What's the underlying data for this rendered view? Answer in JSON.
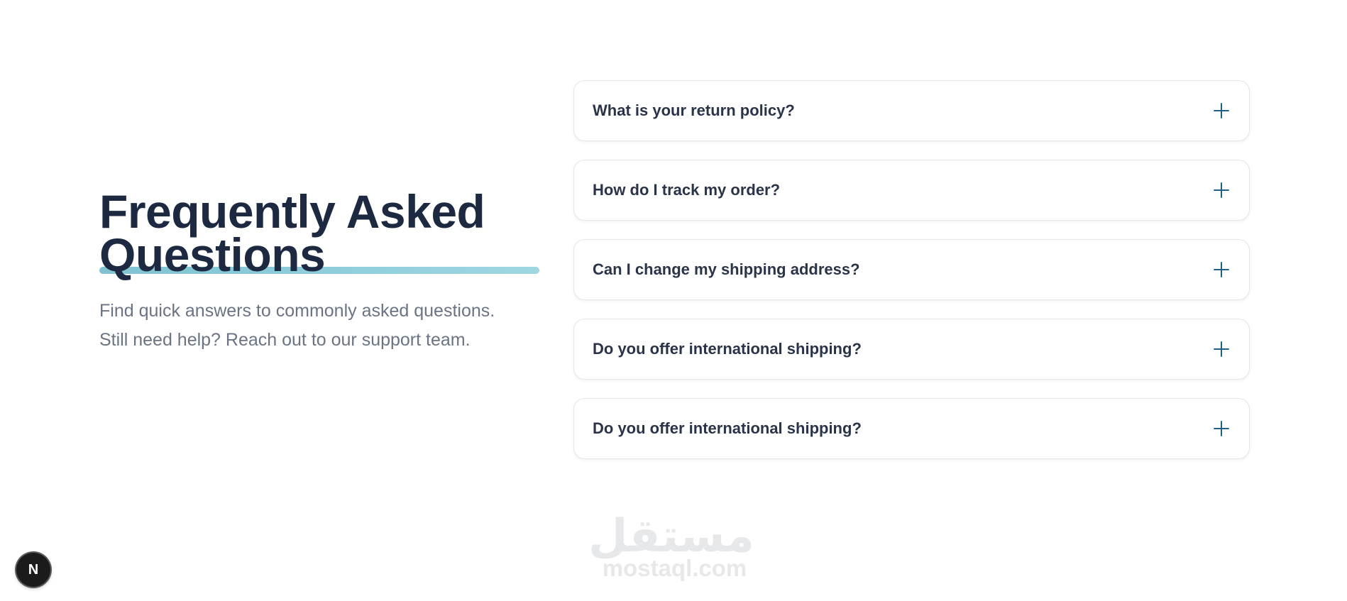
{
  "hero": {
    "title_line1": "Frequently Asked",
    "title_line2": "Questions",
    "description_line1": "Find quick answers to commonly asked questions.",
    "description_line2": "Still need help? Reach out to our support team.",
    "accent_color": "#9fd6e2",
    "title_color": "#1c2940"
  },
  "faq": {
    "expand_icon": "plus-icon",
    "icon_color": "#1f5f86",
    "items": [
      {
        "question": "What is your return policy?"
      },
      {
        "question": "How do I track my order?"
      },
      {
        "question": "Can I change my shipping address?"
      },
      {
        "question": "Do you offer international shipping?"
      },
      {
        "question": "Do you offer international shipping?"
      }
    ]
  },
  "watermark": {
    "arabic": "مستقل",
    "latin": "mostaql.com"
  },
  "dev_badge": {
    "letter": "N",
    "icon": "nextjs-logo-icon"
  }
}
